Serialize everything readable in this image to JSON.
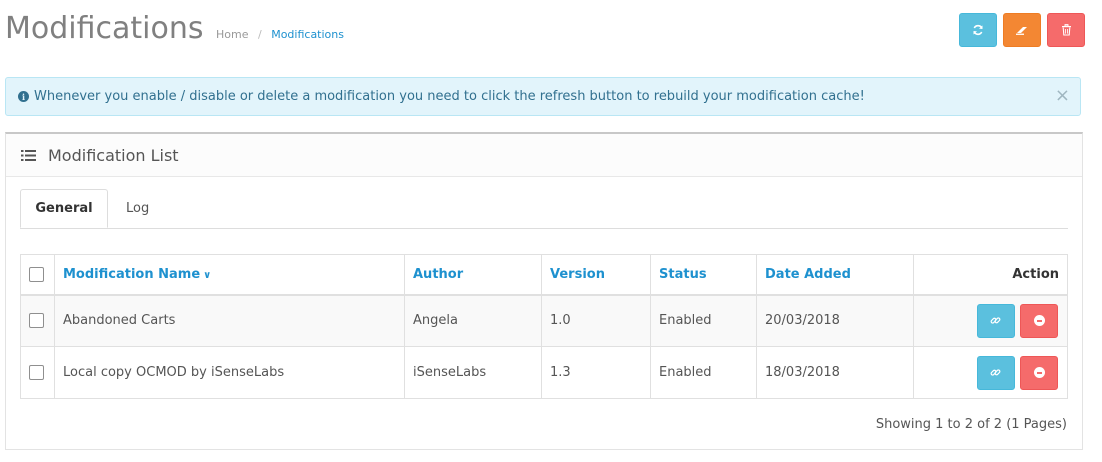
{
  "header": {
    "title": "Modifications",
    "breadcrumb": {
      "home": "Home",
      "separator": "/",
      "current": "Modifications"
    }
  },
  "toolbar": {
    "refresh_icon": "refresh-icon",
    "clear_icon": "eraser-icon",
    "delete_icon": "trash-icon",
    "colors": {
      "info": "#5bc0de",
      "warning": "#f38733",
      "danger": "#f56b6b"
    }
  },
  "alert": {
    "message": "Whenever you enable / disable or delete a modification you need to click the refresh button to rebuild your modification cache!",
    "close": "×"
  },
  "panel": {
    "title": "Modification List",
    "tabs": [
      {
        "label": "General",
        "active": true
      },
      {
        "label": "Log",
        "active": false
      }
    ]
  },
  "table": {
    "columns": {
      "name": "Modification Name",
      "author": "Author",
      "version": "Version",
      "status": "Status",
      "date_added": "Date Added",
      "action": "Action"
    },
    "rows": [
      {
        "name": "Abandoned Carts",
        "author": "Angela",
        "version": "1.0",
        "status": "Enabled",
        "date_added": "20/03/2018"
      },
      {
        "name": "Local copy OCMOD by iSenseLabs",
        "author": "iSenseLabs",
        "version": "1.3",
        "status": "Enabled",
        "date_added": "18/03/2018"
      }
    ]
  },
  "pagination": {
    "text": "Showing 1 to 2 of 2 (1 Pages)"
  },
  "accent_color": "#1e91cf"
}
